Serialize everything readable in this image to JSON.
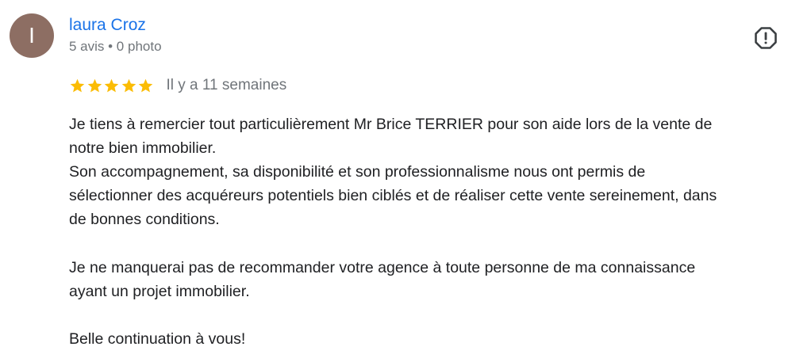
{
  "reviewer": {
    "avatar_letter": "I",
    "avatar_color": "#8d6e63",
    "name": "laura Croz",
    "meta": "5 avis • 0 photo"
  },
  "report_icon": "report-flag-icon",
  "rating": {
    "stars": 5,
    "max_stars": 5,
    "star_color": "#fbbc04",
    "date": "Il y a 11 semaines"
  },
  "review": {
    "lines": [
      "Je tiens à remercier tout particulièrement Mr Brice TERRIER pour son aide lors de la vente de",
      "notre bien immobilier.",
      "Son accompagnement, sa disponibilité et son professionnalisme nous ont permis de",
      "sélectionner des acquéreurs potentiels bien ciblés et de réaliser cette vente sereinement, dans",
      "de bonnes conditions.",
      "",
      "Je ne manquerai pas de recommander votre agence à toute personne de ma connaissance",
      "ayant un projet immobilier.",
      "",
      "Belle continuation à vous!"
    ]
  },
  "colors": {
    "name_link": "#1a73e8",
    "meta_text": "#70757a",
    "body_text": "#202124",
    "icon": "#3c4043"
  }
}
